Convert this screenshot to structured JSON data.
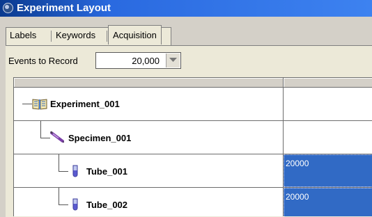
{
  "window": {
    "title": "Experiment Layout"
  },
  "tabs": [
    {
      "label": "Labels",
      "active": false
    },
    {
      "label": "Keywords",
      "active": false
    },
    {
      "label": "Acquisition",
      "active": true
    }
  ],
  "events_to_record": {
    "label": "Events to Record",
    "value": "20,000"
  },
  "tree": [
    {
      "label": "Experiment_001",
      "icon": "book-icon",
      "value": ""
    },
    {
      "label": "Specimen_001",
      "icon": "syringe-icon",
      "value": ""
    },
    {
      "label": "Tube_001",
      "icon": "test-tube-icon",
      "value": "20000"
    },
    {
      "label": "Tube_002",
      "icon": "test-tube-icon",
      "value": "20000"
    }
  ],
  "colors": {
    "title_gradient_start": "#0a3a8f",
    "title_gradient_end": "#3d82f0",
    "selection": "#316ac5"
  }
}
